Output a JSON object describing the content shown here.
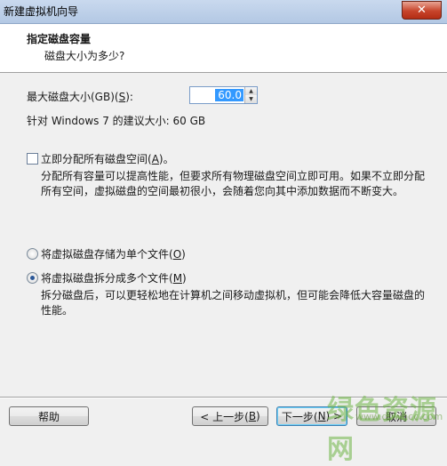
{
  "window": {
    "title": "新建虚拟机向导",
    "close_symbol": "✕"
  },
  "header": {
    "title": "指定磁盘容量",
    "subtitle": "磁盘大小为多少?"
  },
  "max_disk": {
    "label_prefix": "最大磁盘大小(GB)(",
    "label_hotkey": "S",
    "label_suffix": "):",
    "value": "60.0"
  },
  "recommended_text": "针对 Windows 7 的建议大小: 60 GB",
  "allocate": {
    "label_prefix": "立即分配所有磁盘空间(",
    "label_hotkey": "A",
    "label_suffix": ")。",
    "checked": false,
    "description_line1": "分配所有容量可以提高性能，但要求所有物理磁盘空间立即可用。如果不立即分配",
    "description_line2": "所有空间，虚拟磁盘的空间最初很小，会随着您向其中添加数据而不断变大。"
  },
  "storage_options": {
    "single": {
      "label_prefix": "将虚拟磁盘存储为单个文件(",
      "label_hotkey": "O",
      "label_suffix": ")",
      "selected": false
    },
    "split": {
      "label_prefix": "将虚拟磁盘拆分成多个文件(",
      "label_hotkey": "M",
      "label_suffix": ")",
      "selected": true,
      "description_line1": "拆分磁盘后，可以更轻松地在计算机之间移动虚拟机，但可能会降低大容量磁盘的",
      "description_line2": "性能。"
    }
  },
  "buttons": {
    "help": "帮助",
    "back_prefix": "< 上一步(",
    "back_hotkey": "B",
    "back_suffix": ")",
    "next_prefix": "下一步(",
    "next_hotkey": "N",
    "next_suffix": ") >",
    "cancel": "取消"
  },
  "watermark": {
    "text": "绿色资源网",
    "url": "www.downcc.com"
  }
}
